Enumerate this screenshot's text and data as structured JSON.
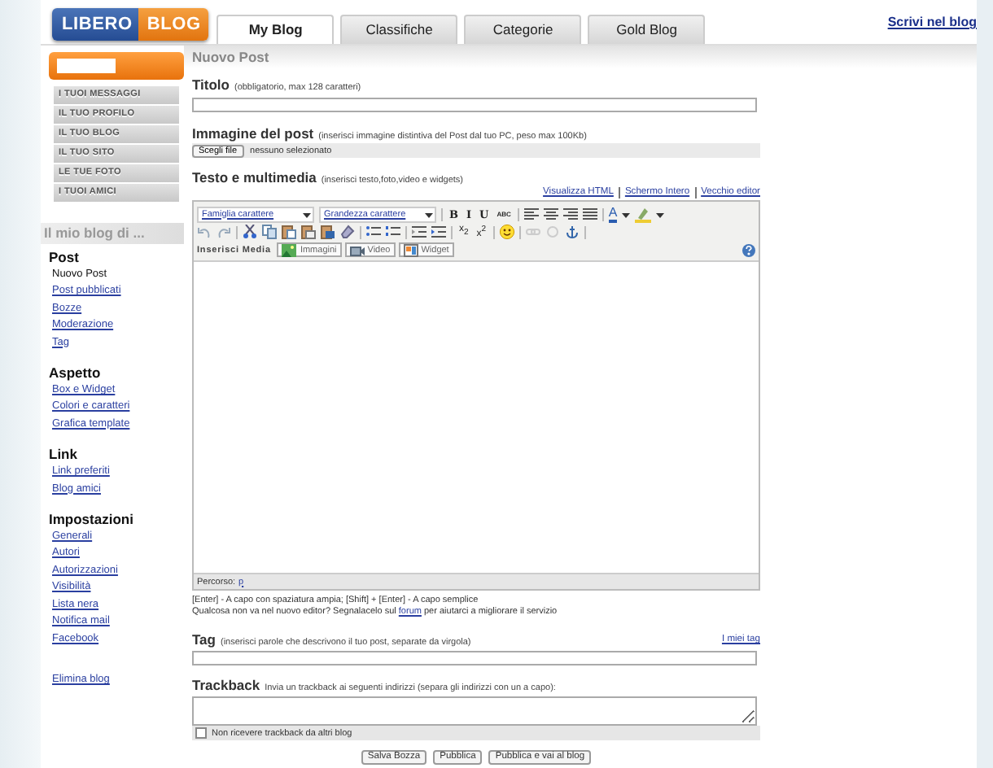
{
  "logo": {
    "first": "LIBERO",
    "second": "BLOG"
  },
  "tabs": [
    {
      "label": "My Blog",
      "selected": true
    },
    {
      "label": "Classifiche",
      "selected": false
    },
    {
      "label": "Categorie",
      "selected": false
    },
    {
      "label": "Gold Blog",
      "selected": false
    }
  ],
  "header_link": "Scrivi nel blog",
  "page_title": "Nuovo Post",
  "sidebar": {
    "menu": [
      "I TUOI MESSAGGI",
      "IL TUO PROFILO",
      "IL TUO BLOG",
      "IL TUO SITO",
      "LE TUE FOTO",
      "I TUOI AMICI"
    ],
    "blog_heading": "Il mio blog di ...",
    "sections": [
      {
        "title": "Post",
        "items": [
          {
            "label": "Nuovo Post",
            "selected": true
          },
          {
            "label": "Post pubblicati",
            "selected": false
          },
          {
            "label": "Bozze",
            "selected": false
          },
          {
            "label": "Moderazione",
            "selected": false
          },
          {
            "label": "Tag",
            "selected": false
          }
        ]
      },
      {
        "title": "Aspetto",
        "items": [
          {
            "label": "Box e Widget",
            "selected": false
          },
          {
            "label": "Colori e caratteri",
            "selected": false
          },
          {
            "label": "Grafica template",
            "selected": false
          }
        ]
      },
      {
        "title": "Link",
        "items": [
          {
            "label": "Link preferiti",
            "selected": false
          },
          {
            "label": "Blog amici",
            "selected": false
          }
        ]
      },
      {
        "title": "Impostazioni",
        "items": [
          {
            "label": "Generali",
            "selected": false
          },
          {
            "label": "Autori",
            "selected": false
          },
          {
            "label": "Autorizzazioni",
            "selected": false
          },
          {
            "label": "Visibilità",
            "selected": false
          },
          {
            "label": "Lista nera",
            "selected": false
          },
          {
            "label": "Notifica mail",
            "selected": false
          },
          {
            "label": "Facebook",
            "selected": false
          }
        ]
      }
    ],
    "footer_link": "Elimina blog"
  },
  "title_field": {
    "label": "Titolo",
    "hint": "(obbligatorio, max 128 caratteri)"
  },
  "image_field": {
    "label": "Immagine del post",
    "hint": "(inserisci immagine distintiva del Post dal tuo PC, peso max 100Kb)",
    "button": "Scegli file",
    "status": "nessuno selezionato"
  },
  "editor": {
    "label": "Testo e multimedia",
    "hint": "(inserisci testo,foto,video e widgets)",
    "links": [
      "Visualizza HTML",
      "Schermo Intero",
      "Vecchio editor"
    ],
    "font_family": "Famiglia carattere",
    "font_size": "Grandezza carattere",
    "format_buttons": [
      "B",
      "I",
      "U",
      "ABC"
    ],
    "text_color": "A",
    "script_buttons": [
      "x$_{2}$",
      "x$^{2}$"
    ],
    "media_label": "Inserisci Media",
    "media_buttons": [
      "Immagini",
      "Video",
      "Widget"
    ],
    "path_label": "Percorso:",
    "path_value": "p"
  },
  "notes": {
    "keys": "[Enter] - A capo con spaziatura ampia; [Shift] + [Enter] - A capo semplice",
    "before": "Qualcosa non va nel nuovo editor? Segnalacelo sul ",
    "link": "forum",
    "after": " per aiutarci a migliorare il servizio"
  },
  "tag_field": {
    "label": "Tag",
    "hint": "(inserisci parole che descrivono il tuo post, separate da virgola)",
    "link": "I miei tag"
  },
  "trackback": {
    "label": "Trackback",
    "hint": "Invia un trackback ai seguenti indirizzi (separa gli indirizzi con un a capo):",
    "checkbox": {
      "label": "Non ricevere trackback da altri blog",
      "checked": false
    }
  },
  "buttons": [
    "Salva Bozza",
    "Pubblica",
    "Pubblica e vai al blog"
  ]
}
